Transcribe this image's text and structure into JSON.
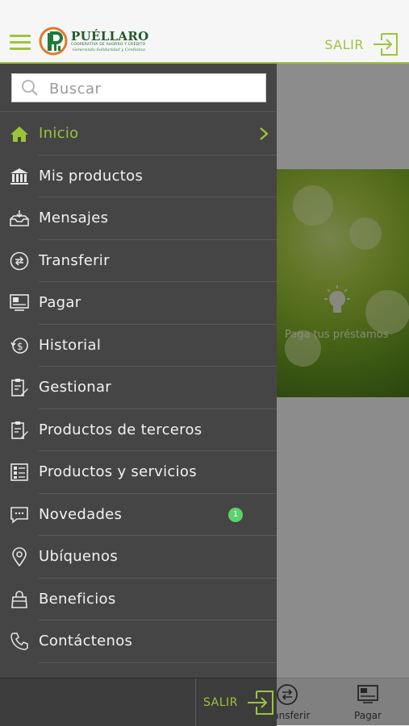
{
  "header": {
    "logo_title": "PUÉLLARO",
    "logo_subtitle": "COOPERATIVA DE AHORRO Y CRÉDITO",
    "logo_tagline": "Generando Solidaridad y Confianza",
    "logout_label": "SALIR"
  },
  "background": {
    "banner_text": "Paga tus préstamos"
  },
  "bottom_nav": {
    "tabs": [
      {
        "label": "Transferir",
        "icon": "transfer-icon"
      },
      {
        "label": "Pagar",
        "icon": "pay-icon"
      }
    ]
  },
  "drawer": {
    "search": {
      "placeholder": "Buscar",
      "value": ""
    },
    "items": [
      {
        "label": "Inicio",
        "icon": "home-icon",
        "active": true
      },
      {
        "label": "Mis productos",
        "icon": "bank-icon"
      },
      {
        "label": "Mensajes",
        "icon": "inbox-icon"
      },
      {
        "label": "Transferir",
        "icon": "transfer-icon"
      },
      {
        "label": "Pagar",
        "icon": "pay-icon"
      },
      {
        "label": "Historial",
        "icon": "history-icon"
      },
      {
        "label": "Gestionar",
        "icon": "clipboard-edit-icon"
      },
      {
        "label": "Productos de terceros",
        "icon": "clipboard-edit-icon"
      },
      {
        "label": "Productos y servicios",
        "icon": "list-icon"
      },
      {
        "label": "Novedades",
        "icon": "chat-icon",
        "badge": "1"
      },
      {
        "label": "Ubíquenos",
        "icon": "location-pin-icon"
      },
      {
        "label": "Beneficios",
        "icon": "bag-icon"
      },
      {
        "label": "Contáctenos",
        "icon": "phone-icon"
      }
    ],
    "logout_label": "SALIR"
  },
  "colors": {
    "accent": "#9cc43a",
    "drawer_bg": "#454545",
    "badge": "#5ad16a"
  }
}
